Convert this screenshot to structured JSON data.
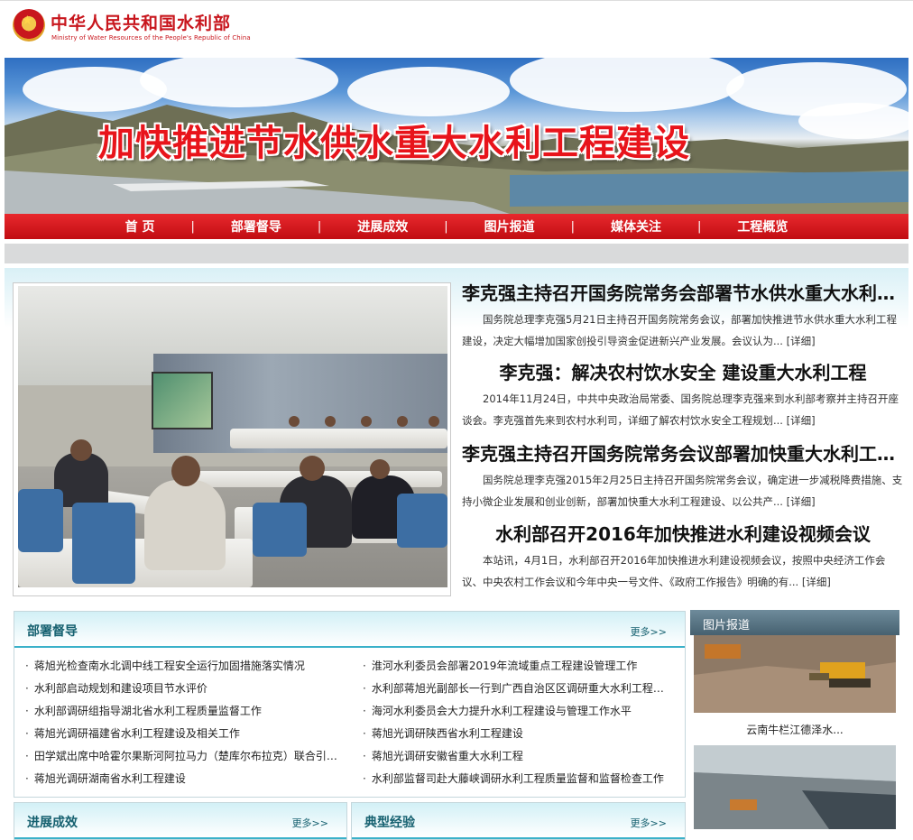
{
  "header": {
    "title": "中华人民共和国水利部",
    "subtitle": "Ministry of Water Resources of the People's Republic of China"
  },
  "banner": {
    "title": "加快推进节水供水重大水利工程建设"
  },
  "nav": {
    "items": [
      "首 页",
      "部署督导",
      "进展成效",
      "图片报道",
      "媒体关注",
      "工程概览"
    ],
    "separator": "|"
  },
  "feature": {
    "articles": [
      {
        "title": "李克强主持召开国务院常务会部署节水供水重大水利工程建设",
        "body": "国务院总理李克强5月21日主持召开国务院常务会议，部署加快推进节水供水重大水利工程建设，决定大幅增加国家创投引导资金促进新兴产业发展。会议认为...",
        "more": "[详细]"
      },
      {
        "title": "李克强：解决农村饮水安全 建设重大水利工程",
        "body": "2014年11月24日，中共中央政治局常委、国务院总理李克强来到水利部考察并主持召开座谈会。李克强首先来到农村水利司，详细了解农村饮水安全工程规划...",
        "more": "[详细]"
      },
      {
        "title": "李克强主持召开国务院常务会议部署加快重大水利工程建设",
        "body": "国务院总理李克强2015年2月25日主持召开国务院常务会议，确定进一步减税降费措施、支持小微企业发展和创业创新，部署加快重大水利工程建设、以公共产...",
        "more": "[详细]"
      },
      {
        "title": "水利部召开2016年加快推进水利建设视频会议",
        "body": "本站讯，4月1日，水利部召开2016年加快推进水利建设视频会议，按照中央经济工作会议、中央农村工作会议和今年中央一号文件、《政府工作报告》明确的有...",
        "more": "[详细]"
      }
    ]
  },
  "deployment": {
    "title": "部署督导",
    "more": "更多>>",
    "bullet": "·",
    "left": [
      "蒋旭光检查南水北调中线工程安全运行加固措施落实情况",
      "水利部启动规划和建设项目节水评价",
      "水利部调研组指导湖北省水利工程质量监督工作",
      "蒋旭光调研福建省水利工程建设及相关工作",
      "田学斌出席中哈霍尔果斯河阿拉马力（楚库尔布拉克）联合引水工程",
      "蒋旭光调研湖南省水利工程建设"
    ],
    "right": [
      "淮河水利委员会部署2019年流域重点工程建设管理工作",
      "水利部蒋旭光副部长一行到广西自治区区调研重大水利工程建设",
      "海河水利委员会大力提升水利工程建设与管理工作水平",
      "蒋旭光调研陕西省水利工程建设",
      "蒋旭光调研安徽省重大水利工程",
      "水利部监督司赴大藤峡调研水利工程质量监督和监督检查工作"
    ]
  },
  "progress": {
    "title": "进展成效",
    "more": "更多>>"
  },
  "experience": {
    "title": "典型经验",
    "more": "更多>>"
  },
  "photo_report": {
    "title": "图片报道",
    "caption": "云南牛栏江德泽水..."
  }
}
